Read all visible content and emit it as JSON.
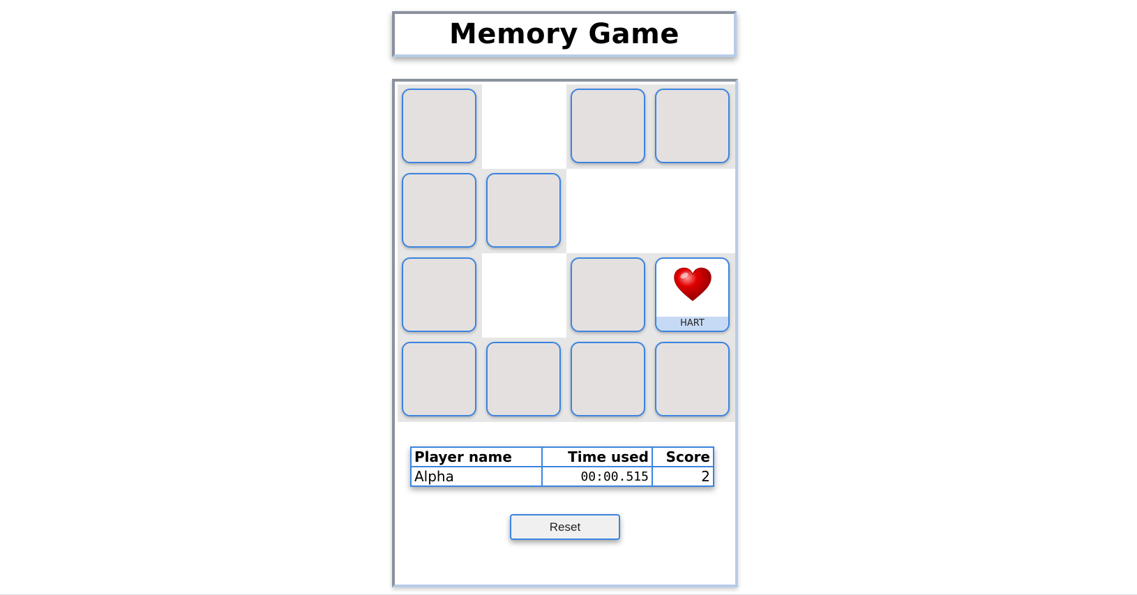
{
  "header": {
    "title": "Memory Game"
  },
  "board": {
    "rows": 4,
    "cols": 4,
    "cells": [
      {
        "state": "face-down"
      },
      {
        "state": "removed"
      },
      {
        "state": "face-down"
      },
      {
        "state": "face-down"
      },
      {
        "state": "face-down"
      },
      {
        "state": "face-down"
      },
      {
        "state": "removed"
      },
      {
        "state": "removed"
      },
      {
        "state": "face-down"
      },
      {
        "state": "removed"
      },
      {
        "state": "face-down"
      },
      {
        "state": "face-up",
        "label": "HART",
        "icon": "heart-icon"
      },
      {
        "state": "face-down"
      },
      {
        "state": "face-down"
      },
      {
        "state": "face-down"
      },
      {
        "state": "face-down"
      }
    ]
  },
  "scoreboard": {
    "headers": {
      "name": "Player name",
      "time": "Time used",
      "score": "Score"
    },
    "rows": [
      {
        "name": "Alpha",
        "time": "00:00.515",
        "score": "2"
      }
    ]
  },
  "controls": {
    "reset_label": "Reset"
  },
  "colors": {
    "card_border": "#3a84df",
    "card_back": "#e4e0e0",
    "cell_background": "#e7e6e6",
    "label_background": "#c7daf5",
    "heart": "#e00000"
  }
}
